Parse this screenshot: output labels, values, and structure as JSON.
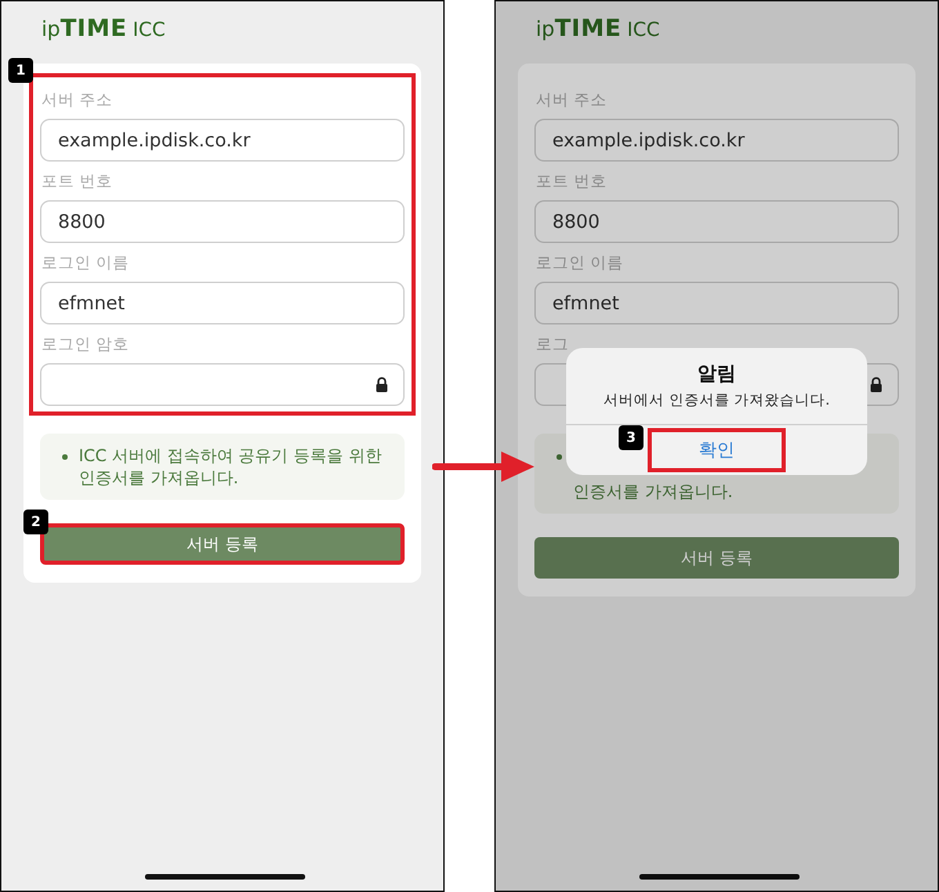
{
  "screens": [
    {
      "logo": "ip**TIME**",
      "product": "ICC",
      "fields_callout": "1",
      "fields": [
        {
          "kind": "text",
          "label": "서버 주소",
          "value": "example.ipdisk.co.kr"
        },
        {
          "kind": "text",
          "label": "포트 번호",
          "value": "8800"
        },
        {
          "kind": "text",
          "label": "로그인 이름",
          "value": "efmnet"
        },
        {
          "kind": "password",
          "label": "로그인 암호"
        }
      ],
      "note_lines": [
        "ICC 서버에 접속하여 공유기 등록을 위한",
        "인증서를 가져옵니다."
      ],
      "button": "서버 등록",
      "button_callout": "2"
    },
    {
      "logo": "ip**TIME**",
      "product": "ICC",
      "dimmed": true,
      "fields": [
        {
          "kind": "text",
          "label": "서버 주소",
          "value": "example.ipdisk.co.kr"
        },
        {
          "kind": "text",
          "label": "포트 번호",
          "value": "8800"
        },
        {
          "kind": "text",
          "label": "로그인 이름",
          "value": "efmnet"
        },
        {
          "kind": "password",
          "label": "로그"
        }
      ],
      "note_lines": [
        "인증서를 가져옵니다."
      ],
      "button": "서버 등록",
      "alert": {
        "title": "알림",
        "message": "서버에서 인증서를 가져왔습니다.",
        "button": "확인",
        "callout": "3"
      }
    }
  ]
}
